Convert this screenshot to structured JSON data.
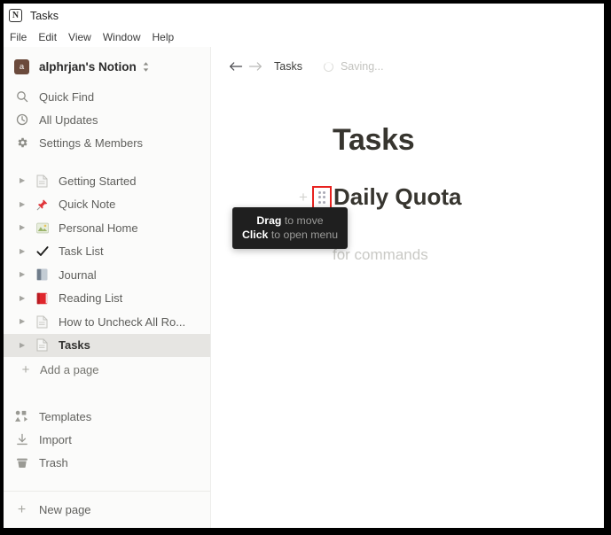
{
  "window": {
    "title": "Tasks",
    "logo_icon": "notion-logo-icon"
  },
  "menubar": {
    "items": [
      {
        "label": "File"
      },
      {
        "label": "Edit"
      },
      {
        "label": "View"
      },
      {
        "label": "Window"
      },
      {
        "label": "Help"
      }
    ]
  },
  "sidebar": {
    "workspace": {
      "avatar_letter": "a",
      "avatar_color": "#6b4a3c",
      "name": "alphrjan's Notion",
      "chevron_icon": "chevron-updown-icon"
    },
    "nav": [
      {
        "label": "Quick Find",
        "icon": "search-icon"
      },
      {
        "label": "All Updates",
        "icon": "clock-icon"
      },
      {
        "label": "Settings & Members",
        "icon": "gear-icon"
      }
    ],
    "pages": [
      {
        "label": "Getting Started",
        "icon": "document-icon",
        "selected": false
      },
      {
        "label": "Quick Note",
        "icon": "pushpin-icon",
        "selected": false
      },
      {
        "label": "Personal Home",
        "icon": "house-picture-icon",
        "selected": false
      },
      {
        "label": "Task List",
        "icon": "checkmark-icon",
        "selected": false
      },
      {
        "label": "Journal",
        "icon": "blue-book-icon",
        "selected": false
      },
      {
        "label": "Reading List",
        "icon": "red-book-icon",
        "selected": false
      },
      {
        "label": "How to Uncheck All Ro...",
        "icon": "document-icon",
        "selected": false
      },
      {
        "label": "Tasks",
        "icon": "document-icon",
        "selected": true
      }
    ],
    "add_page": {
      "label": "Add a page",
      "icon": "plus-icon"
    },
    "utilities": [
      {
        "label": "Templates",
        "icon": "templates-icon"
      },
      {
        "label": "Import",
        "icon": "import-icon"
      },
      {
        "label": "Trash",
        "icon": "trash-icon"
      }
    ],
    "footer": {
      "label": "New page",
      "icon": "plus-icon"
    }
  },
  "topbar": {
    "back_icon": "arrow-left-icon",
    "forward_icon": "arrow-right-icon",
    "breadcrumb": "Tasks",
    "status_icon": "spinner-icon",
    "status_text": "Saving..."
  },
  "page": {
    "title": "Tasks",
    "block": {
      "add_icon": "plus-icon",
      "drag_handle_icon": "drag-handle-dots-icon",
      "text": "Daily Quota",
      "highlight_color": "#e8221f"
    },
    "placeholder": "for commands"
  },
  "tooltip": {
    "line1_bold": "Drag",
    "line1_rest": " to move",
    "line2_bold": "Click",
    "line2_rest": " to open menu"
  }
}
